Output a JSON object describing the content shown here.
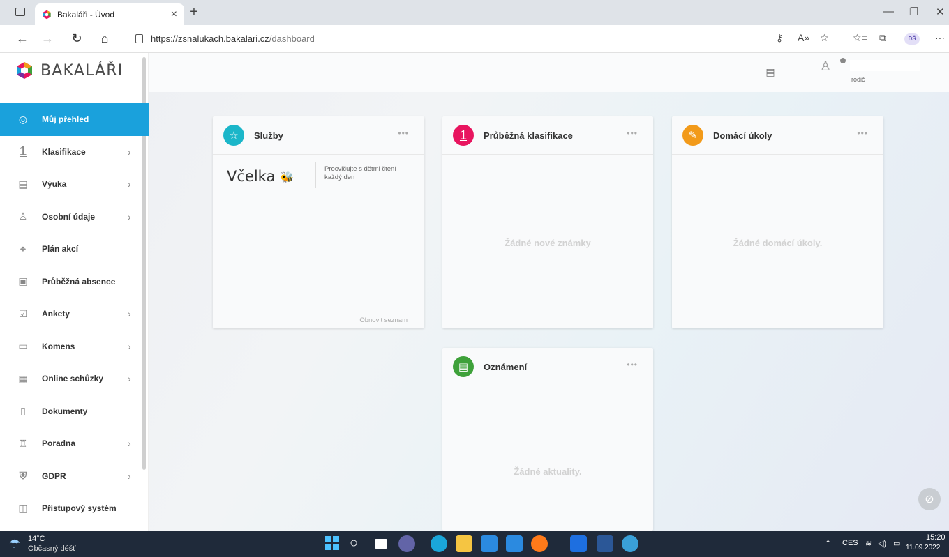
{
  "browser": {
    "tab_title": "Bakaláři - Úvod",
    "tab_close": "×",
    "new_tab": "+",
    "url_host": "https://zsnalukach.bakalari.cz",
    "url_path": "/dashboard",
    "profile_initials": "DŠ"
  },
  "app": {
    "logo_text": "BAKALÁŘI",
    "user_role": "rodič",
    "accent_color": "#1aa1dc"
  },
  "sidebar": {
    "items": [
      {
        "label": "Můj přehled",
        "icon": "gauge-icon",
        "active": true
      },
      {
        "label": "Klasifikace",
        "icon": "grade-one-icon"
      },
      {
        "label": "Výuka",
        "icon": "books-icon"
      },
      {
        "label": "Osobní údaje",
        "icon": "person-card-icon"
      },
      {
        "label": "Plán akcí",
        "icon": "map-pin-icon"
      },
      {
        "label": "Průběžná absence",
        "icon": "absence-icon"
      },
      {
        "label": "Ankety",
        "icon": "checkbox-icon"
      },
      {
        "label": "Komens",
        "icon": "chat-icon"
      },
      {
        "label": "Online schůzky",
        "icon": "video-meeting-icon"
      },
      {
        "label": "Dokumenty",
        "icon": "document-icon"
      },
      {
        "label": "Poradna",
        "icon": "counseling-icon"
      },
      {
        "label": "GDPR",
        "icon": "shield-icon"
      },
      {
        "label": "Přístupový systém",
        "icon": "access-card-icon"
      }
    ]
  },
  "cards": {
    "services": {
      "title": "Služby",
      "service_name": "Včelka",
      "service_desc": "Procvičujte s dětmi čtení každý den",
      "refresh": "Obnovit seznam",
      "icon_color": "#1bb6c9"
    },
    "grades": {
      "title": "Průběžná klasifikace",
      "empty": "Žádné nové známky",
      "icon_text": "1",
      "icon_color": "#e8155f"
    },
    "homework": {
      "title": "Domácí úkoly",
      "empty": "Žádné domácí úkoly.",
      "icon_color": "#f29a1a"
    },
    "news": {
      "title": "Oznámení",
      "empty": "Žádné aktuality.",
      "icon_color": "#3ea13a"
    },
    "menu_dots": "•••"
  },
  "taskbar": {
    "temperature": "14°C",
    "weather": "Občasný déšť",
    "language": "CES",
    "time": "15:20",
    "date": "11.09.2022"
  }
}
